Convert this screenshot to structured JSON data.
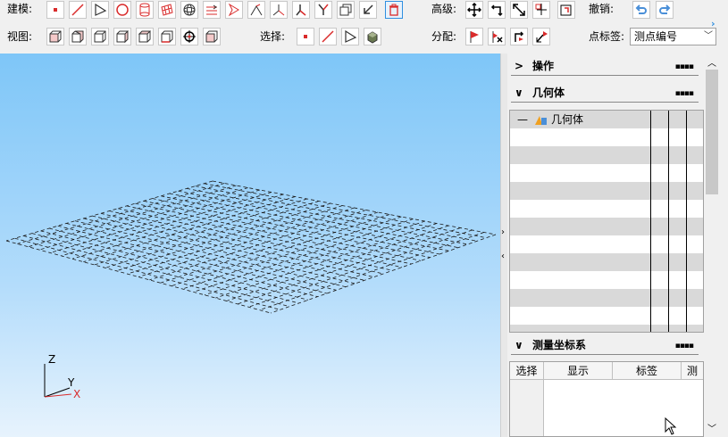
{
  "toolbar": {
    "modeling_label": "建模:",
    "view_label": "视图:",
    "advanced_label": "高级:",
    "undo_label": "撤销:",
    "select_label": "选择:",
    "assign_label": "分配:",
    "point_label_label": "点标签:",
    "point_label_value": "测点编号"
  },
  "panel": {
    "operations_title": "操作",
    "geometry_title": "几何体",
    "tree_root": "几何体",
    "coord_title": "测量坐标系",
    "coord_columns": [
      "选择",
      "显示",
      "标签",
      "测"
    ]
  },
  "axes": {
    "z": "Z",
    "y": "Y",
    "x": "X"
  },
  "colors": {
    "accent_red": "#d92b2b",
    "viewport_top": "#7ec6f8",
    "delete_blue": "#2f8fe0"
  }
}
